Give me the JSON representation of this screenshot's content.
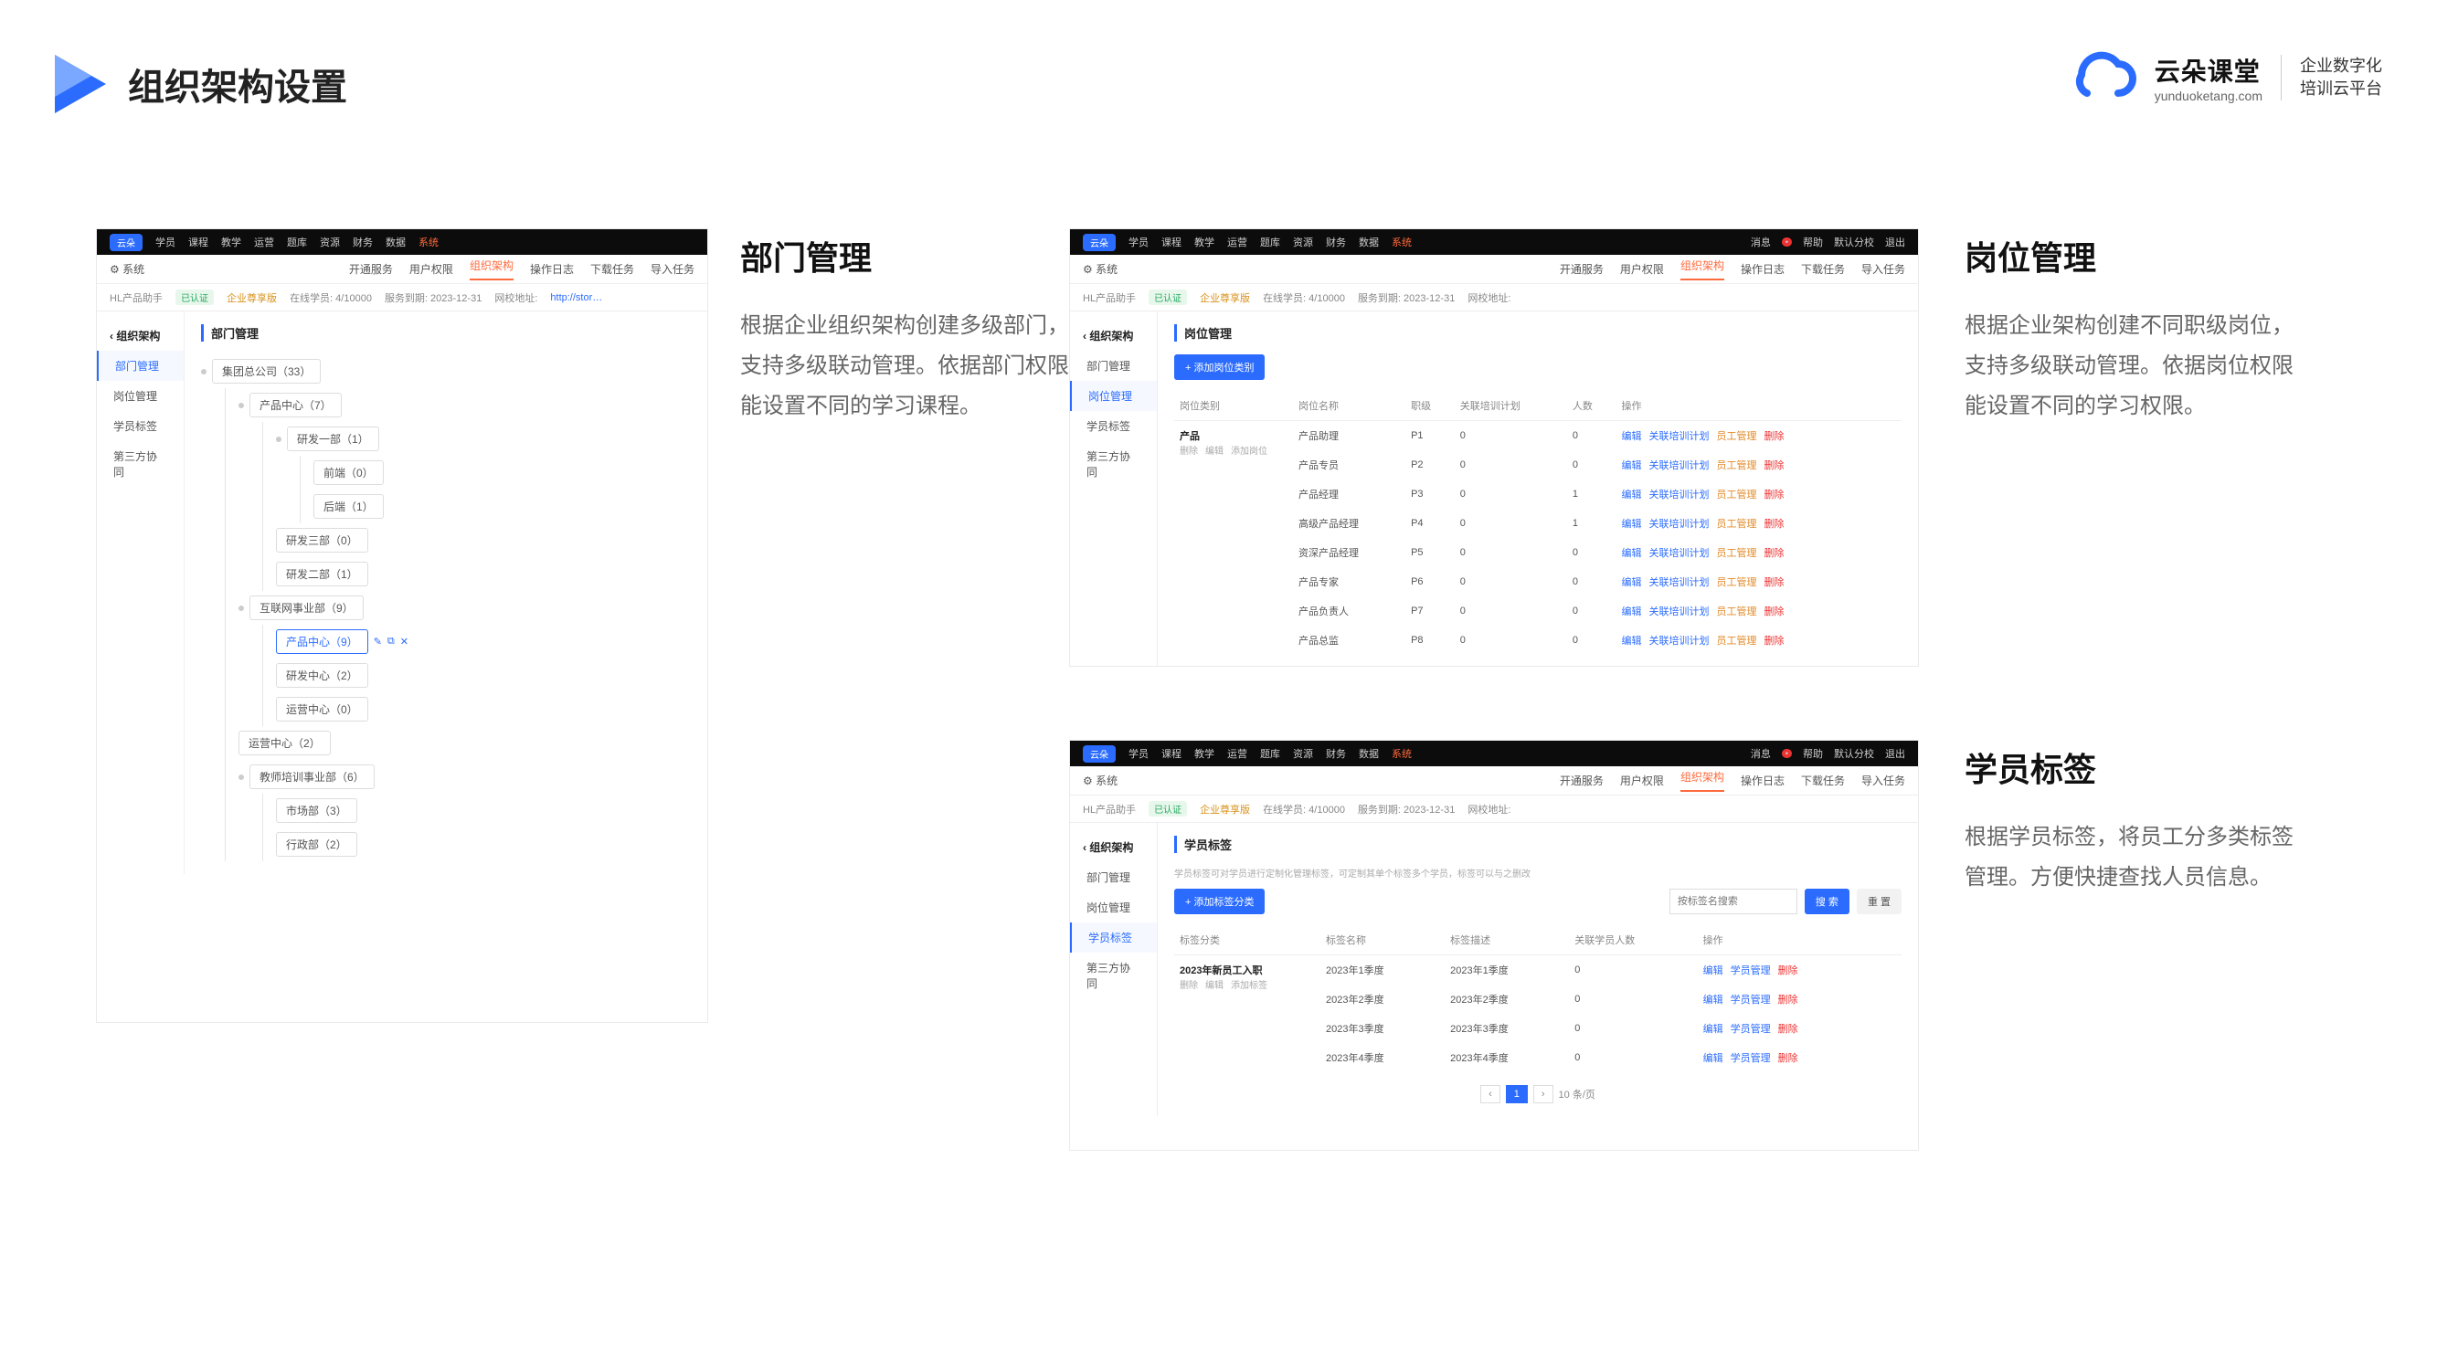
{
  "header": {
    "title": "组织架构设置"
  },
  "brand": {
    "cn": "云朵课堂",
    "en": "yunduoketang.com",
    "sub1": "企业数字化",
    "sub2": "培训云平台"
  },
  "sections": {
    "dept": {
      "title": "部门管理",
      "desc": "根据企业组织架构创建多级部门，支持多级联动管理。依据部门权限能设置不同的学习课程。"
    },
    "post": {
      "title": "岗位管理",
      "desc": "根据企业架构创建不同职级岗位，支持多级联动管理。依据岗位权限能设置不同的学习权限。"
    },
    "tag": {
      "title": "学员标签",
      "desc": "根据学员标签，将员工分多类标签管理。方便快捷查找人员信息。"
    }
  },
  "top_nav": [
    "学员",
    "课程",
    "教学",
    "运营",
    "题库",
    "资源",
    "财务",
    "数据",
    "系统"
  ],
  "top_right": [
    "消息",
    "帮助",
    "默认分校",
    "退出"
  ],
  "sub_tabs": [
    "开通服务",
    "用户权限",
    "组织架构",
    "操作日志",
    "下载任务",
    "导入任务"
  ],
  "infobar": {
    "org": "HL产品助手",
    "verified": "已认证",
    "plan": "企业尊享版",
    "online": "在线学员: 4/10000",
    "expire": "服务到期: 2023-12-31",
    "domain_label": "网校地址:"
  },
  "side_title": "组织架构",
  "side_items": [
    "部门管理",
    "岗位管理",
    "学员标签",
    "第三方协同"
  ],
  "dept": {
    "main_title": "部门管理",
    "tree": {
      "root": "集团总公司（33）",
      "l1": [
        {
          "label": "产品中心（7）",
          "children": [
            {
              "label": "研发一部（1）",
              "children": [
                {
                  "label": "前端（0）"
                },
                {
                  "label": "后端（1）"
                }
              ]
            },
            {
              "label": "研发三部（0）"
            },
            {
              "label": "研发二部（1）"
            }
          ]
        },
        {
          "label": "互联网事业部（9）",
          "children": [
            {
              "label": "产品中心（9）",
              "selected": true
            },
            {
              "label": "研发中心（2）"
            },
            {
              "label": "运营中心（0）"
            }
          ]
        },
        {
          "label": "运营中心（2）"
        },
        {
          "label": "教师培训事业部（6）",
          "children": [
            {
              "label": "市场部（3）"
            },
            {
              "label": "行政部（2）"
            }
          ]
        }
      ]
    }
  },
  "post": {
    "main_title": "岗位管理",
    "add_btn": "+ 添加岗位类别",
    "columns": [
      "岗位类别",
      "岗位名称",
      "职级",
      "关联培训计划",
      "人数",
      "操作"
    ],
    "group": {
      "name": "产品",
      "meta": [
        "删除",
        "编辑",
        "添加岗位"
      ]
    },
    "rows": [
      {
        "name": "产品助理",
        "rank": "P1",
        "plans": 0,
        "count": 0
      },
      {
        "name": "产品专员",
        "rank": "P2",
        "plans": 0,
        "count": 0
      },
      {
        "name": "产品经理",
        "rank": "P3",
        "plans": 0,
        "count": 1
      },
      {
        "name": "高级产品经理",
        "rank": "P4",
        "plans": 0,
        "count": 1
      },
      {
        "name": "资深产品经理",
        "rank": "P5",
        "plans": 0,
        "count": 0
      },
      {
        "name": "产品专家",
        "rank": "P6",
        "plans": 0,
        "count": 0
      },
      {
        "name": "产品负责人",
        "rank": "P7",
        "plans": 0,
        "count": 0
      },
      {
        "name": "产品总监",
        "rank": "P8",
        "plans": 0,
        "count": 0
      }
    ],
    "ops": [
      "编辑",
      "关联培训计划",
      "员工管理",
      "删除"
    ]
  },
  "tag": {
    "main_title": "学员标签",
    "hint": "学员标签可对学员进行定制化管理标签，可定制其单个标签多个学员，标签可以与之删改",
    "add_btn": "+ 添加标签分类",
    "search_placeholder": "按标签名搜索",
    "search_btn": "搜 索",
    "reset_btn": "重 置",
    "columns": [
      "标签分类",
      "标签名称",
      "标签描述",
      "关联学员人数",
      "操作"
    ],
    "group": {
      "name": "2023年新员工入职",
      "meta": [
        "删除",
        "编辑",
        "添加标签"
      ]
    },
    "rows": [
      {
        "name": "2023年1季度",
        "desc": "2023年1季度",
        "count": 0
      },
      {
        "name": "2023年2季度",
        "desc": "2023年2季度",
        "count": 0
      },
      {
        "name": "2023年3季度",
        "desc": "2023年3季度",
        "count": 0
      },
      {
        "name": "2023年4季度",
        "desc": "2023年4季度",
        "count": 0
      }
    ],
    "ops": [
      "编辑",
      "学员管理",
      "删除"
    ],
    "pager": {
      "page": "1",
      "size": "10 条/页"
    }
  }
}
